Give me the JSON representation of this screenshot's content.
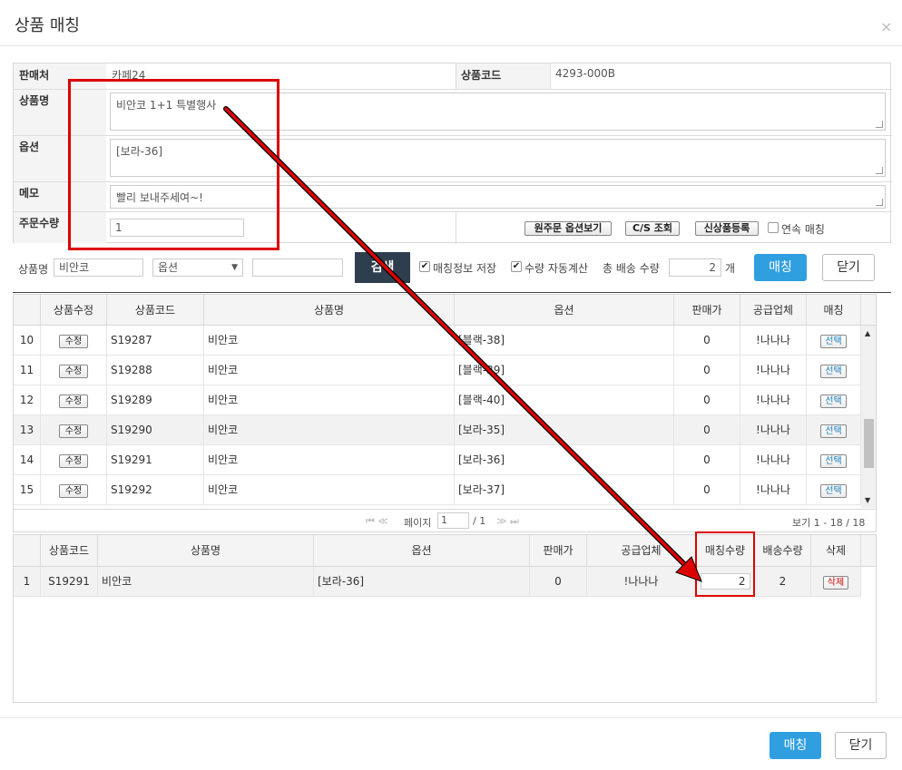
{
  "dialog": {
    "title": "상품 매칭",
    "close": "×"
  },
  "info": {
    "seller_label": "판매처",
    "seller_value": "카페24",
    "code_label": "상품코드",
    "code_value": "4293-000B",
    "name_label": "상품명",
    "name_value": "비안코 1+1 특별행사",
    "option_label": "옵션",
    "option_value": "[보라-36]",
    "memo_label": "메모",
    "memo_value": "빨리 보내주세여~!",
    "qty_label": "주문수량",
    "qty_value": "1",
    "btn_option_view": "원주문 옵션보기",
    "btn_cs": "C/S 조회",
    "btn_new_product": "신상품등록",
    "continuous_label": "연속 매칭"
  },
  "search": {
    "name_label": "상품명",
    "name_value": "비안코",
    "option_select": "옵션",
    "option_input": "",
    "search_btn": "검색",
    "save_match_label": "매칭정보 저장",
    "auto_calc_label": "수량 자동계산",
    "total_ship_label": "총 배송 수량",
    "total_ship_value": "2",
    "unit": "개",
    "match_btn": "매칭",
    "close_btn": "닫기"
  },
  "results": {
    "headers": [
      "",
      "상품수정",
      "상품코드",
      "상품명",
      "옵션",
      "판매가",
      "공급업체",
      "매칭"
    ],
    "edit_label": "수정",
    "select_label": "선택",
    "rows": [
      {
        "no": "10",
        "code": "S19287",
        "name": "비안코",
        "option": "[블랙-38]",
        "price": "0",
        "supplier": "!나나나"
      },
      {
        "no": "11",
        "code": "S19288",
        "name": "비안코",
        "option": "[블랙-39]",
        "price": "0",
        "supplier": "!나나나"
      },
      {
        "no": "12",
        "code": "S19289",
        "name": "비안코",
        "option": "[블랙-40]",
        "price": "0",
        "supplier": "!나나나"
      },
      {
        "no": "13",
        "code": "S19290",
        "name": "비안코",
        "option": "[보라-35]",
        "price": "0",
        "supplier": "!나나나"
      },
      {
        "no": "14",
        "code": "S19291",
        "name": "비안코",
        "option": "[보라-36]",
        "price": "0",
        "supplier": "!나나나"
      },
      {
        "no": "15",
        "code": "S19292",
        "name": "비안코",
        "option": "[보라-37]",
        "price": "0",
        "supplier": "!나나나"
      }
    ],
    "pager": {
      "page_label": "페이지",
      "page_value": "1",
      "total_pages": "/ 1",
      "summary": "보기 1 - 18 / 18"
    }
  },
  "matched": {
    "headers": [
      "",
      "상품코드",
      "상품명",
      "옵션",
      "판매가",
      "공급업체",
      "매칭수량",
      "배송수량",
      "삭제"
    ],
    "delete_label": "삭제",
    "rows": [
      {
        "no": "1",
        "code": "S19291",
        "name": "비안코",
        "option": "[보라-36]",
        "price": "0",
        "supplier": "!나나나",
        "match_qty": "2",
        "ship_qty": "2"
      }
    ]
  },
  "footer": {
    "match_btn": "매칭",
    "close_btn": "닫기"
  },
  "colors": {
    "accent": "#2f9fe0",
    "dark_btn": "#2f3e4e",
    "highlight": "#dd0000"
  }
}
